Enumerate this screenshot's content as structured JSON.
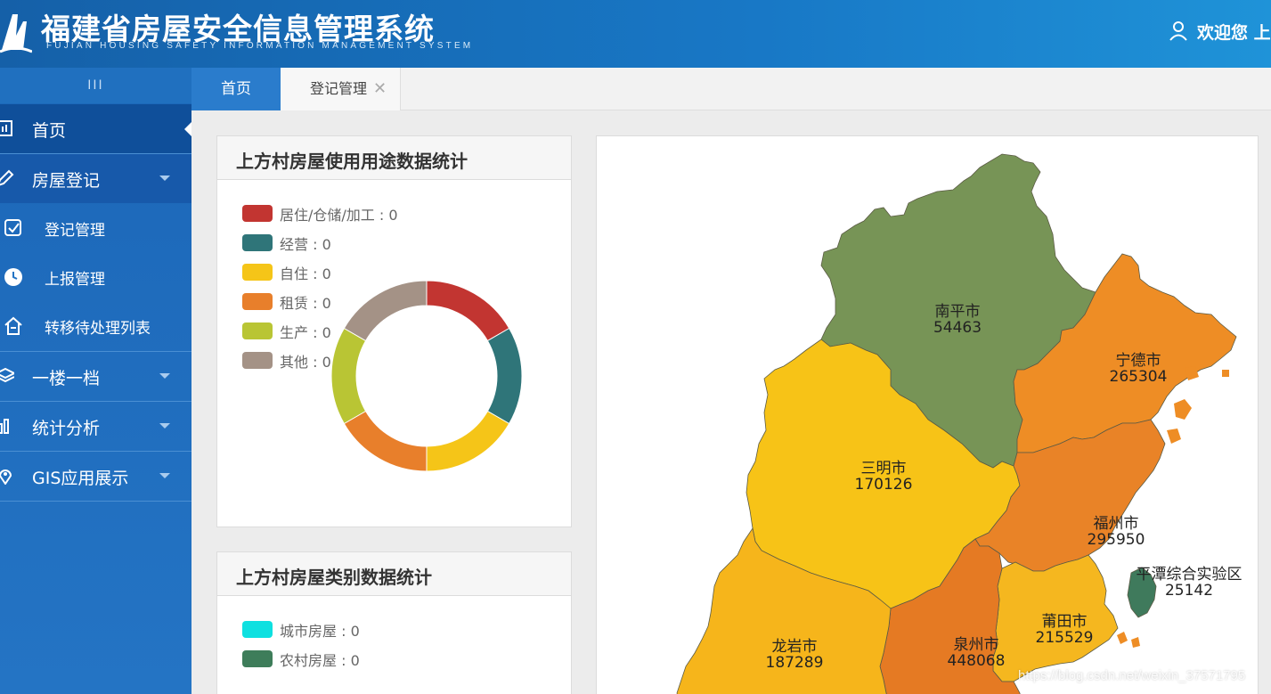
{
  "header": {
    "title": "福建省房屋安全信息管理系统",
    "subtitle": "FUJIAN HOUSING SAFETY INFORMATION MANAGEMENT SYSTEM",
    "welcome": "欢迎您 上"
  },
  "sidebar": {
    "toggle": "III",
    "items": [
      {
        "label": "首页",
        "icon": "dashboard-icon"
      },
      {
        "label": "房屋登记",
        "icon": "edit-icon"
      },
      {
        "label": "登记管理",
        "icon": "checkbox-icon"
      },
      {
        "label": "上报管理",
        "icon": "clock-icon"
      },
      {
        "label": "转移待处理列表",
        "icon": "home-icon"
      },
      {
        "label": "一楼一档",
        "icon": "layers-icon"
      },
      {
        "label": "统计分析",
        "icon": "bar-chart-icon"
      },
      {
        "label": "GIS应用展示",
        "icon": "map-pin-icon"
      }
    ]
  },
  "tabs": [
    {
      "label": "首页"
    },
    {
      "label": "登记管理",
      "close": "✕"
    }
  ],
  "usage_panel": {
    "title": "上方村房屋使用用途数据统计",
    "legend": [
      {
        "label": "居住/仓储/加工 : 0",
        "color": "#c23531"
      },
      {
        "label": "经营 : 0",
        "color": "#2f7579"
      },
      {
        "label": "自住 : 0",
        "color": "#f5c518"
      },
      {
        "label": "租赁 : 0",
        "color": "#e87f2b"
      },
      {
        "label": "生产 : 0",
        "color": "#b9c534"
      },
      {
        "label": "其他 : 0",
        "color": "#a49286"
      }
    ]
  },
  "category_panel": {
    "title": "上方村房屋类别数据统计",
    "legend": [
      {
        "label": "城市房屋 : 0",
        "color": "#0ee0e0"
      },
      {
        "label": "农村房屋 : 0",
        "color": "#3e7d5a"
      }
    ]
  },
  "map": {
    "cities": [
      {
        "name": "南平市",
        "value": "54463",
        "color": "#779456"
      },
      {
        "name": "宁德市",
        "value": "265304",
        "color": "#ee8d25"
      },
      {
        "name": "三明市",
        "value": "170126",
        "color": "#f7c317"
      },
      {
        "name": "福州市",
        "value": "295950",
        "color": "#e98327"
      },
      {
        "name": "平潭综合实验区",
        "value": "25142",
        "color": "#3f7a5c"
      },
      {
        "name": "莆田市",
        "value": "215529",
        "color": "#f5b71f"
      },
      {
        "name": "泉州市",
        "value": "448068",
        "color": "#e57a23"
      },
      {
        "name": "龙岩市",
        "value": "187289",
        "color": "#f6b51b"
      }
    ]
  },
  "watermark": "https://blog.csdn.net/weixin_37571795"
}
